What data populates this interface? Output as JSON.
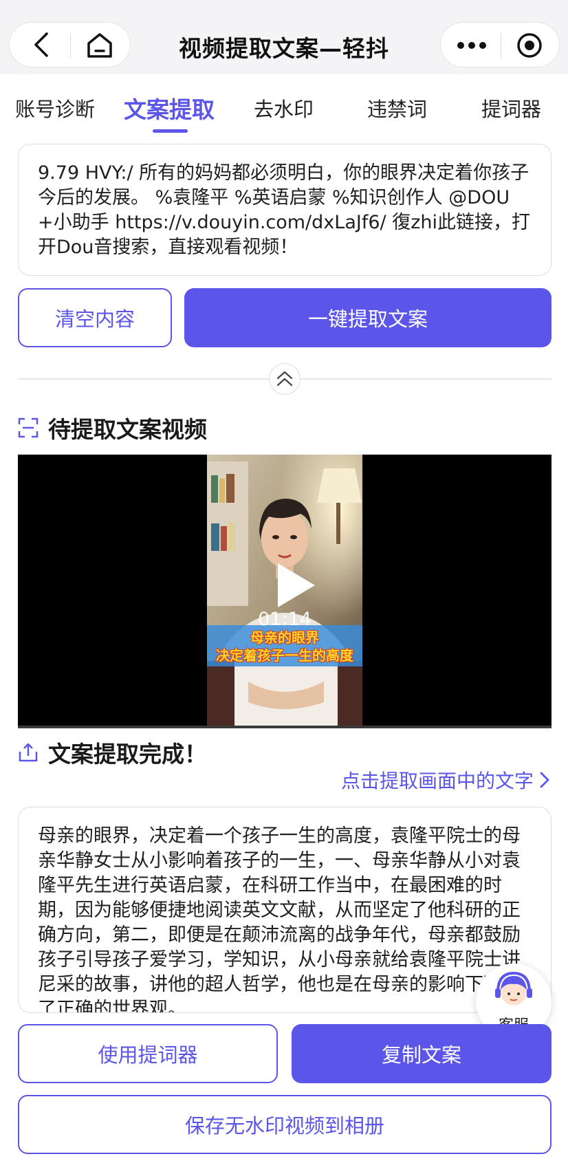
{
  "header": {
    "title": "视频提取文案—轻抖"
  },
  "tabs": [
    {
      "label": "账号诊断"
    },
    {
      "label": "文案提取"
    },
    {
      "label": "去水印"
    },
    {
      "label": "违禁词"
    },
    {
      "label": "提词器"
    }
  ],
  "link_input": {
    "value": "9.79 HVY:/ 所有的妈妈都必须明白，你的眼界决定着你孩子今后的发展。 %袁隆平 %英语启蒙 %知识创作人 @DOU+小助手 https://v.douyin.com/dxLaJf6/ 復zhi此链接，打开Dou音搜索，直接观看视频！"
  },
  "actions": {
    "clear_label": "清空内容",
    "extract_label": "一键提取文案"
  },
  "video_section": {
    "title": "待提取文案视频",
    "duration": "01:14",
    "caption_line1": "母亲的眼界",
    "caption_line2": "决定着孩子一生的高度"
  },
  "result_section": {
    "title": "文案提取完成！",
    "extract_frame_text": "点击提取画面中的文字",
    "text": "母亲的眼界，决定着一个孩子一生的高度，袁隆平院士的母亲华静女士从小影响着孩子的一生，一、母亲华静从小对袁隆平先生进行英语启蒙，在科研工作当中，在最困难的时期，因为能够便捷地阅读英文文献，从而坚定了他科研的正确方向，第二，即便是在颠沛流离的战争年代，母亲都鼓励孩子引导孩子爱学习，学知识，从小母亲就给袁隆平院士讲尼采的故事，讲他的超人哲学，他也是在母亲的影响下形成了正确的世界观。"
  },
  "bottom_actions": {
    "teleprompter_label": "使用提词器",
    "copy_label": "复制文案",
    "save_label": "保存无水印视频到相册"
  },
  "customer_service": {
    "label": "客服"
  },
  "colors": {
    "accent": "#5b55ea",
    "border": "#dcdce2",
    "topbar_bg": "#f4f4f6"
  }
}
